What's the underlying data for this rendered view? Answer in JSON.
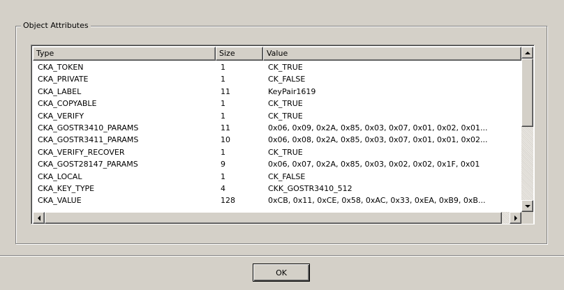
{
  "group": {
    "label": "Object Attributes"
  },
  "table": {
    "columns": [
      "Type",
      "Size",
      "Value"
    ],
    "rows": [
      {
        "type": "CKA_TOKEN",
        "size": "1",
        "value": "CK_TRUE"
      },
      {
        "type": "CKA_PRIVATE",
        "size": "1",
        "value": "CK_FALSE"
      },
      {
        "type": "CKA_LABEL",
        "size": "11",
        "value": "KeyPair1619"
      },
      {
        "type": "CKA_COPYABLE",
        "size": "1",
        "value": "CK_TRUE"
      },
      {
        "type": "CKA_VERIFY",
        "size": "1",
        "value": "CK_TRUE"
      },
      {
        "type": "CKA_GOSTR3410_PARAMS",
        "size": "11",
        "value": "0x06, 0x09, 0x2A, 0x85, 0x03, 0x07, 0x01, 0x02, 0x01..."
      },
      {
        "type": "CKA_GOSTR3411_PARAMS",
        "size": "10",
        "value": "0x06, 0x08, 0x2A, 0x85, 0x03, 0x07, 0x01, 0x01, 0x02..."
      },
      {
        "type": "CKA_VERIFY_RECOVER",
        "size": "1",
        "value": "CK_TRUE"
      },
      {
        "type": "CKA_GOST28147_PARAMS",
        "size": "9",
        "value": "0x06, 0x07, 0x2A, 0x85, 0x03, 0x02, 0x02, 0x1F, 0x01"
      },
      {
        "type": "CKA_LOCAL",
        "size": "1",
        "value": "CK_FALSE"
      },
      {
        "type": "CKA_KEY_TYPE",
        "size": "4",
        "value": "CKK_GOSTR3410_512"
      },
      {
        "type": "CKA_VALUE",
        "size": "128",
        "value": "0xCB, 0x11, 0xCE, 0x58, 0xAC, 0x33, 0xEA, 0xB9, 0xB..."
      }
    ]
  },
  "buttons": {
    "ok": "OK"
  },
  "icons": {
    "scroll_up": "arrow-up-icon",
    "scroll_down": "arrow-down-icon",
    "scroll_left": "arrow-left-icon",
    "scroll_right": "arrow-right-icon"
  }
}
